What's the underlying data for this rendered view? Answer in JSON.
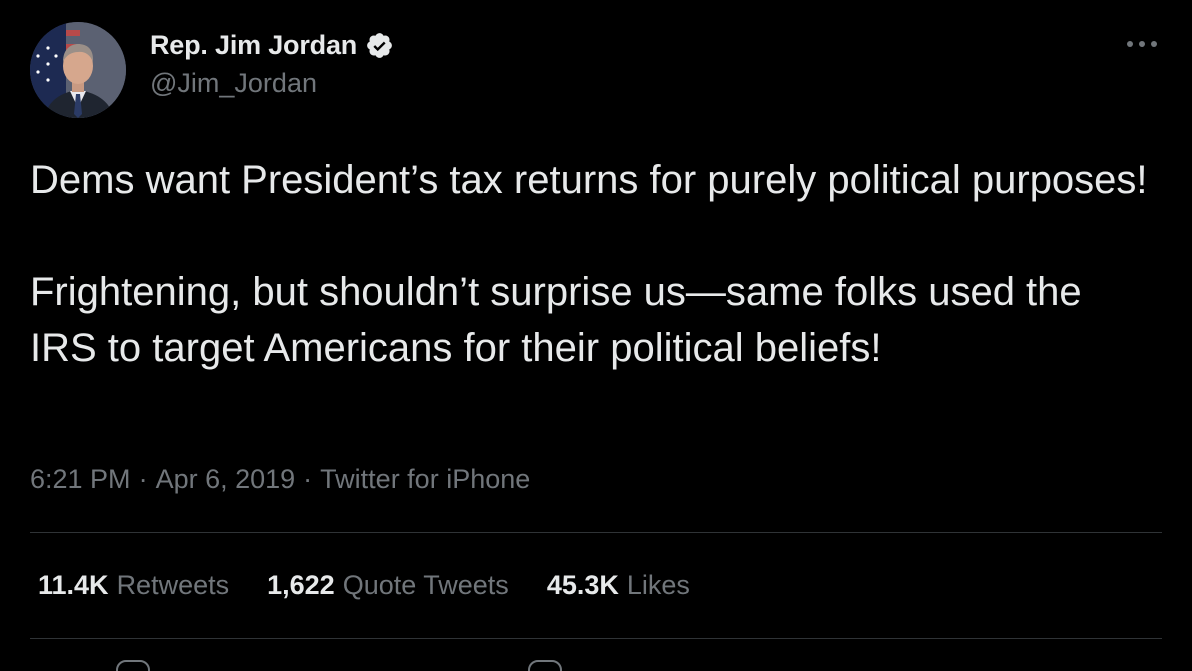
{
  "author": {
    "display_name": "Rep. Jim Jordan",
    "handle": "@Jim_Jordan",
    "verified": true
  },
  "tweet": {
    "paragraphs": [
      "Dems want President’s tax returns for purely political purposes!",
      "Frightening, but shouldn’t surprise us—same folks used the IRS to target Americans for their political beliefs!"
    ],
    "time": "6:21 PM",
    "separator": "·",
    "date": "Apr 6, 2019",
    "source": "Twitter for iPhone"
  },
  "stats": {
    "retweets": {
      "count": "11.4K",
      "label": "Retweets"
    },
    "quote_tweets": {
      "count": "1,622",
      "label": "Quote Tweets"
    },
    "likes": {
      "count": "45.3K",
      "label": "Likes"
    }
  },
  "icons": {
    "verified": "verified-badge-icon",
    "more": "more-horizontal-icon"
  },
  "colors": {
    "background": "#000000",
    "text_primary": "#e7e9ea",
    "text_secondary": "#71767b",
    "divider": "#2f3336"
  }
}
